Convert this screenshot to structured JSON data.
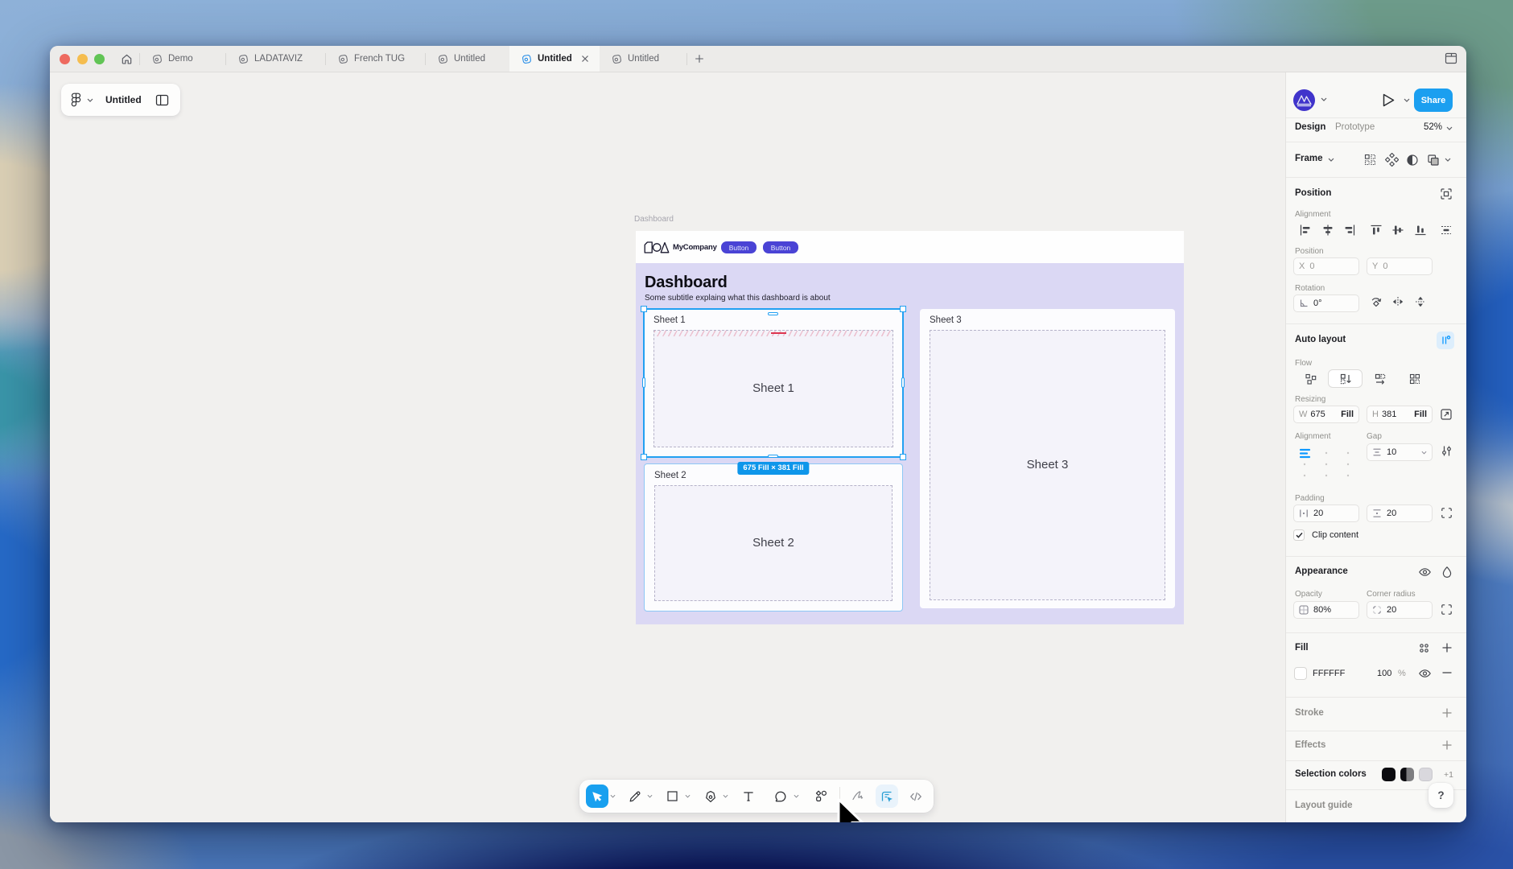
{
  "tabbar": {
    "tabs": [
      {
        "label": "Demo"
      },
      {
        "label": "LADATAVIZ"
      },
      {
        "label": "French TUG"
      },
      {
        "label": "Untitled"
      },
      {
        "label": "Untitled"
      },
      {
        "label": "Untitled"
      }
    ]
  },
  "file_pill": {
    "title": "Untitled"
  },
  "canvas": {
    "frame_label": "Dashboard",
    "header": {
      "brand": "MyCompany",
      "button1": "Button",
      "button2": "Button"
    },
    "title": "Dashboard",
    "subtitle": "Some subtitle explaing what this dashboard is about",
    "sheets": [
      {
        "title": "Sheet 1",
        "label": "Sheet 1"
      },
      {
        "title": "Sheet 2",
        "label": "Sheet 2"
      },
      {
        "title": "Sheet 3",
        "label": "Sheet 3"
      }
    ],
    "selection_badge": "675 Fill × 381 Fill"
  },
  "sidebar": {
    "share_label": "Share",
    "tabs": {
      "design": "Design",
      "prototype": "Prototype"
    },
    "zoom": "52%",
    "frame": {
      "label": "Frame"
    },
    "position": {
      "header": "Position",
      "alignment_label": "Alignment",
      "position_label": "Position",
      "x_label": "X",
      "x_value": "0",
      "y_label": "Y",
      "y_value": "0",
      "rotation_label": "Rotation",
      "rotation_value": "0°"
    },
    "auto_layout": {
      "header": "Auto layout",
      "flow_label": "Flow",
      "resizing_label": "Resizing",
      "w_label": "W",
      "w_value": "675",
      "w_mode": "Fill",
      "h_label": "H",
      "h_value": "381",
      "h_mode": "Fill",
      "alignment_label": "Alignment",
      "gap_label": "Gap",
      "gap_value": "10",
      "padding_label": "Padding",
      "padding_h": "20",
      "padding_v": "20",
      "clip_label": "Clip content"
    },
    "appearance": {
      "header": "Appearance",
      "opacity_label": "Opacity",
      "opacity_value": "80%",
      "corner_label": "Corner radius",
      "corner_value": "20"
    },
    "fill": {
      "header": "Fill",
      "hex": "FFFFFF",
      "opacity": "100",
      "unit": "%"
    },
    "stroke_label": "Stroke",
    "effects_label": "Effects",
    "selection_colors_label": "Selection colors",
    "more_colors": "+1",
    "layout_guide_label": "Layout guide",
    "help_label": "?"
  },
  "colors": {
    "accent_blue": "#0d99ff",
    "share_blue": "#1b9ff0",
    "button_indigo": "#4a43d5",
    "frame_lavender": "#dbd8f4",
    "selection_blue": "#22a0f2"
  }
}
